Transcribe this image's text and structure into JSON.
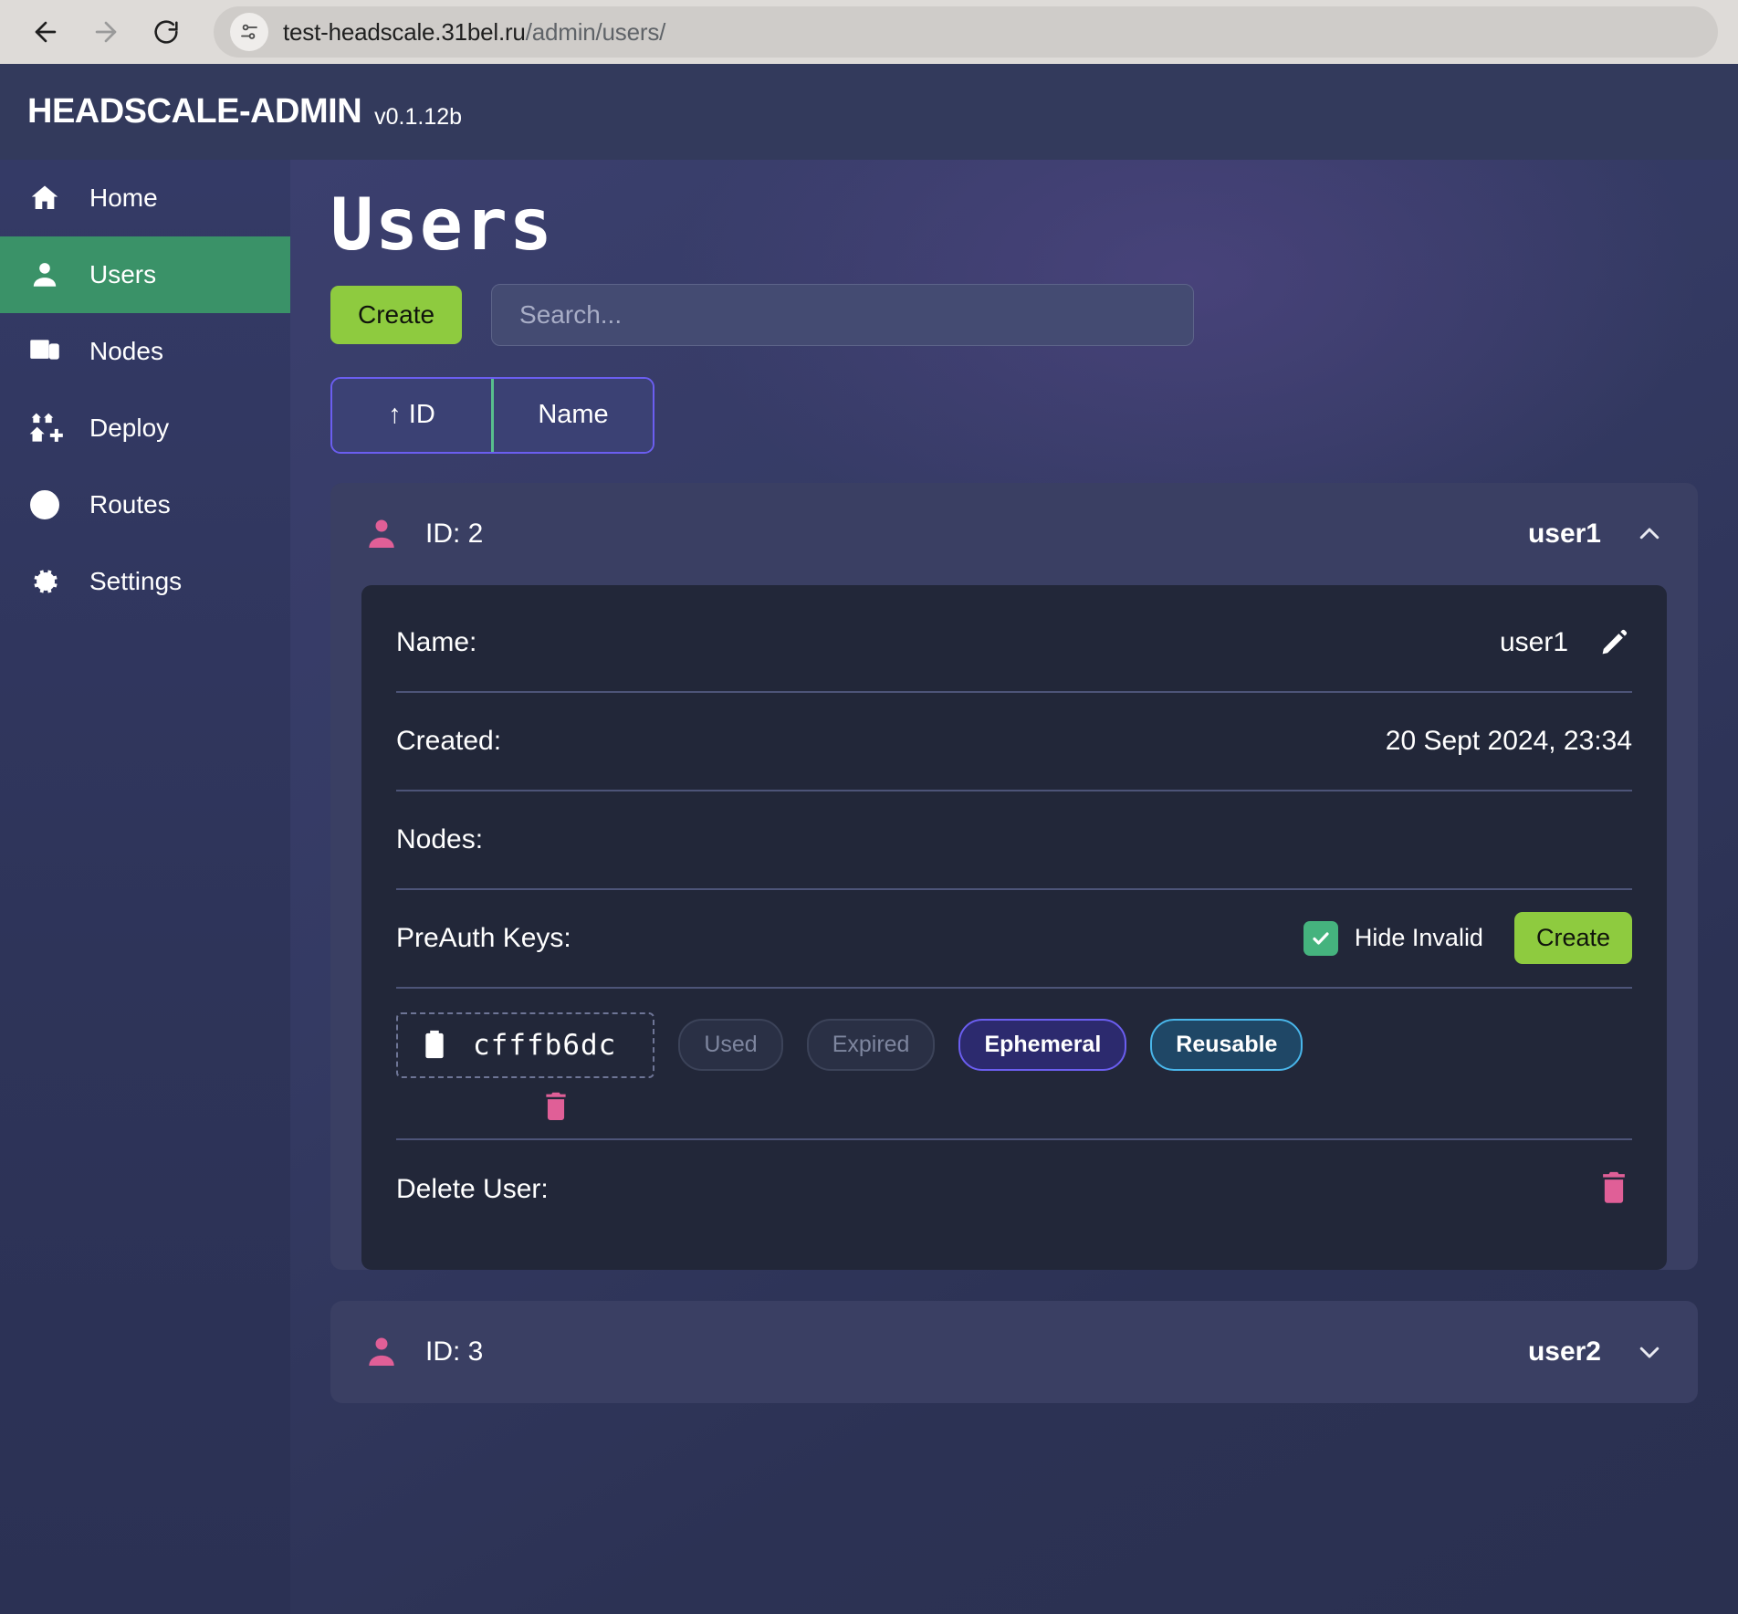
{
  "browser": {
    "back_icon": "arrow-left-icon",
    "forward_icon": "arrow-right-icon",
    "reload_icon": "reload-icon",
    "site_info_icon": "site-settings-icon",
    "url_host": "test-headscale.31bel.ru",
    "url_path": "/admin/users/"
  },
  "header": {
    "title": "HEADSCALE-ADMIN",
    "version": "v0.1.12b"
  },
  "sidebar": {
    "items": [
      {
        "label": "Home",
        "icon": "home-icon",
        "active": false
      },
      {
        "label": "Users",
        "icon": "user-icon",
        "active": true
      },
      {
        "label": "Nodes",
        "icon": "devices-icon",
        "active": false
      },
      {
        "label": "Deploy",
        "icon": "deploy-icon",
        "active": false
      },
      {
        "label": "Routes",
        "icon": "routes-icon",
        "active": false
      },
      {
        "label": "Settings",
        "icon": "gear-icon",
        "active": false
      }
    ]
  },
  "page": {
    "title": "Users",
    "create_label": "Create",
    "search_placeholder": "Search...",
    "search_value": "",
    "sorters": [
      {
        "label": "↑ ID",
        "active": true
      },
      {
        "label": "Name",
        "active": false
      }
    ]
  },
  "users": [
    {
      "id_label": "ID: 2",
      "name": "user1",
      "expanded": true,
      "chevron": "chevron-up-icon",
      "details": {
        "name_label": "Name:",
        "name_value": "user1",
        "created_label": "Created:",
        "created_value": "20 Sept 2024, 23:34",
        "nodes_label": "Nodes:",
        "nodes_value": "",
        "preauth_label": "PreAuth Keys:",
        "hide_invalid_label": "Hide Invalid",
        "hide_invalid_checked": true,
        "preauth_create_label": "Create",
        "delete_label": "Delete User:",
        "keys": [
          {
            "key": "cfffb6dc",
            "badges": [
              {
                "label": "Used",
                "state": "off"
              },
              {
                "label": "Expired",
                "state": "off"
              },
              {
                "label": "Ephemeral",
                "state": "ephemeral"
              },
              {
                "label": "Reusable",
                "state": "reusable"
              }
            ]
          }
        ]
      }
    },
    {
      "id_label": "ID: 3",
      "name": "user2",
      "expanded": false,
      "chevron": "chevron-down-icon"
    }
  ],
  "colors": {
    "accent_green": "#8ecb3f",
    "active_nav": "#3a9268",
    "pink": "#e05f97",
    "purple_border": "#6b5ef0",
    "cyan_border": "#49b6ea"
  }
}
